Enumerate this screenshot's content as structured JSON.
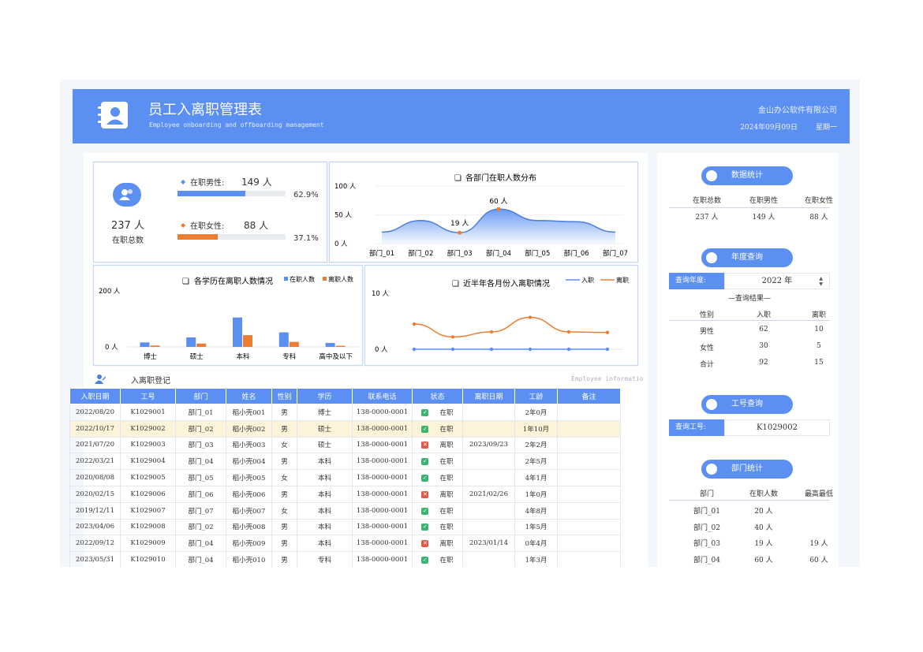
{
  "header": {
    "title": "员工入离职管理表",
    "subtitle": "Employee onboarding and offboarding management",
    "company": "金山办公软件有限公司",
    "date": "2024年09月09日",
    "weekday": "星期一"
  },
  "summary": {
    "total_value": "237 人",
    "total_label": "在职总数",
    "male_label": "在职男性:",
    "male_value": "149 人",
    "male_pct": "62.9%",
    "male_ratio": 0.629,
    "female_label": "在职女性:",
    "female_value": "88 人",
    "female_pct": "37.1%",
    "female_ratio": 0.371
  },
  "charts": {
    "dept": {
      "title": "各部门在职人数分布",
      "ticks": [
        "100 人",
        "50 人",
        "0 人"
      ],
      "labels": [
        "19 人",
        "60 人"
      ]
    },
    "edu": {
      "title": "各学历在离职人数情况",
      "legend_on": "在职人数",
      "legend_off": "离职人数",
      "ticks": [
        "200 人",
        "0 人"
      ]
    },
    "monthly": {
      "title": "近半年各月份入离职情况",
      "legend_in": "入职",
      "legend_out": "离职",
      "ticks": [
        "10 人",
        "0 人"
      ]
    }
  },
  "chart_data": [
    {
      "type": "area",
      "title": "各部门在职人数分布",
      "categories": [
        "部门_01",
        "部门_02",
        "部门_03",
        "部门_04",
        "部门_05",
        "部门_06",
        "部门_07"
      ],
      "values": [
        20,
        40,
        19,
        60,
        40,
        38,
        20
      ],
      "ylim": [
        0,
        100
      ],
      "color": "#5b8ff2"
    },
    {
      "type": "bar",
      "title": "各学历在离职人数情况",
      "categories": [
        "博士",
        "硕士",
        "本科",
        "专科",
        "高中及以下"
      ],
      "series": [
        {
          "name": "在职人数",
          "values": [
            16,
            34,
            105,
            52,
            14
          ],
          "color": "#5b8ff2"
        },
        {
          "name": "离职人数",
          "values": [
            5,
            12,
            42,
            18,
            4
          ],
          "color": "#ed7d31"
        }
      ],
      "ylim": [
        0,
        200
      ]
    },
    {
      "type": "line",
      "title": "近半年各月份入离职情况",
      "x": [
        1,
        2,
        3,
        4,
        5,
        6
      ],
      "series": [
        {
          "name": "入职",
          "values": [
            0,
            0,
            0,
            0,
            0,
            0
          ],
          "color": "#5b8ff2"
        },
        {
          "name": "离职",
          "values": [
            4.5,
            2.2,
            3.1,
            5.7,
            3.1,
            3.0
          ],
          "color": "#ed7d31"
        }
      ],
      "ylim": [
        0,
        10
      ]
    }
  ],
  "register": {
    "title": "入离职登记",
    "title_en": "Employee informatio",
    "headers": [
      "入职日期",
      "工号",
      "部门",
      "姓名",
      "性别",
      "学历",
      "联系电话",
      "状态",
      "离职日期",
      "工龄",
      "备注"
    ],
    "rows": [
      [
        "2022/08/20",
        "K1029001",
        "部门_01",
        "稻小壳001",
        "男",
        "博士",
        "138-0000-0001",
        "在职",
        "",
        "2年0月",
        ""
      ],
      [
        "2022/10/17",
        "K1029002",
        "部门_02",
        "稻小壳002",
        "男",
        "硕士",
        "138-0000-0001",
        "在职",
        "",
        "1年10月",
        ""
      ],
      [
        "2021/07/20",
        "K1029003",
        "部门_03",
        "稻小壳003",
        "女",
        "硕士",
        "138-0000-0001",
        "离职",
        "2023/09/23",
        "2年2月",
        ""
      ],
      [
        "2022/03/21",
        "K1029004",
        "部门_04",
        "稻小壳004",
        "男",
        "本科",
        "138-0000-0001",
        "在职",
        "",
        "2年5月",
        ""
      ],
      [
        "2020/08/08",
        "K1029005",
        "部门_05",
        "稻小壳005",
        "女",
        "本科",
        "138-0000-0001",
        "在职",
        "",
        "4年1月",
        ""
      ],
      [
        "2020/02/15",
        "K1029006",
        "部门_06",
        "稻小壳006",
        "男",
        "本科",
        "138-0000-0001",
        "离职",
        "2021/02/26",
        "1年0月",
        ""
      ],
      [
        "2019/12/11",
        "K1029007",
        "部门_07",
        "稻小壳007",
        "女",
        "本科",
        "138-0000-0001",
        "在职",
        "",
        "4年8月",
        ""
      ],
      [
        "2023/04/06",
        "K1029008",
        "部门_02",
        "稻小壳008",
        "男",
        "本科",
        "138-0000-0001",
        "在职",
        "",
        "1年5月",
        ""
      ],
      [
        "2022/09/12",
        "K1029009",
        "部门_04",
        "稻小壳009",
        "男",
        "本科",
        "138-0000-0001",
        "离职",
        "2023/01/14",
        "0年4月",
        ""
      ],
      [
        "2023/05/31",
        "K1029010",
        "部门_04",
        "稻小壳010",
        "男",
        "专科",
        "138-0000-0001",
        "在职",
        "",
        "1年3月",
        ""
      ]
    ]
  },
  "stats": {
    "button": "数据统计",
    "headers": [
      "在职总数",
      "在职男性",
      "在职女性"
    ],
    "values": [
      "237 人",
      "149 人",
      "88 人"
    ]
  },
  "year_query": {
    "button": "年度查询",
    "label": "查询年度:",
    "value": "2022 年",
    "result_title": "—查询结果—",
    "headers": [
      "性别",
      "入职",
      "离职"
    ],
    "rows": [
      [
        "男性",
        "62",
        "10"
      ],
      [
        "女性",
        "30",
        "5"
      ],
      [
        "合计",
        "92",
        "15"
      ]
    ]
  },
  "id_query": {
    "button": "工号查询",
    "label": "查询工号:",
    "value": "K1029002"
  },
  "dept_stats": {
    "button": "部门统计",
    "headers": [
      "部门",
      "在职人数",
      "最高最低"
    ],
    "rows": [
      [
        "部门_01",
        "20 人",
        ""
      ],
      [
        "部门_02",
        "40 人",
        ""
      ],
      [
        "部门_03",
        "19 人",
        "19 人"
      ],
      [
        "部门_04",
        "60 人",
        "60 人"
      ]
    ]
  },
  "colors": {
    "accent": "#5b8ff2",
    "orange": "#ed7d31",
    "highlight_row": "#fdf3d8"
  }
}
